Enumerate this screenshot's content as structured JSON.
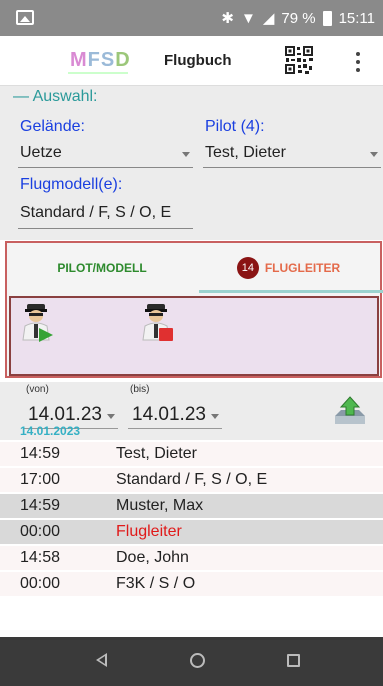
{
  "status_bar": {
    "battery": "79 %",
    "time": "15:11",
    "icons": [
      "image-icon",
      "bluetooth-icon",
      "wifi-icon",
      "signal-icon",
      "battery-icon"
    ]
  },
  "app_bar": {
    "logo": "MFSD",
    "title": "Flugbuch",
    "qr_icon": "qr-code-icon",
    "menu_icon": "more-vert-icon"
  },
  "selection": {
    "header": "— Auswahl:",
    "gelaende_label": "Gelände:",
    "gelaende_value": "Uetze",
    "pilot_label": "Pilot (4):",
    "pilot_value": "Test, Dieter",
    "flugmodell_label": "Flugmodell(e):",
    "flugmodell_value": "Standard / F, S / O, E"
  },
  "tabs": {
    "pilot_modell": "PILOT/MODELL",
    "flugleiter": "FLUGLEITER",
    "badge": "14",
    "active": "FLUGLEITER"
  },
  "actions": [
    {
      "name": "start-flight-leader",
      "icon": "pilot-play-icon"
    },
    {
      "name": "stop-flight-leader",
      "icon": "pilot-stop-icon"
    }
  ],
  "dates": {
    "von_label": "(von)",
    "bis_label": "(bis)",
    "von_value": "14.01.23",
    "bis_value": "14.01.23",
    "upload_icon": "upload-icon"
  },
  "list": {
    "date_header": "14.01.2023",
    "rows": [
      {
        "time": "14:59",
        "text": "Test, Dieter",
        "style": "white"
      },
      {
        "time": "17:00",
        "text": "Standard / F, S / O, E",
        "style": "white"
      },
      {
        "time": "14:59",
        "text": "Muster, Max",
        "style": "gray"
      },
      {
        "time": "00:00",
        "text": "Flugleiter",
        "style": "gray",
        "highlight": "#e01a1a"
      },
      {
        "time": "14:58",
        "text": "Doe, John",
        "style": "white"
      },
      {
        "time": "00:00",
        "text": "F3K / S / O",
        "style": "white"
      }
    ]
  },
  "colors": {
    "accent_teal": "#2b9a9a",
    "label_blue": "#1a3fe0",
    "tab_green": "#2d8a2d",
    "tab_orange": "#e46a4a",
    "border_red": "#c86060"
  }
}
